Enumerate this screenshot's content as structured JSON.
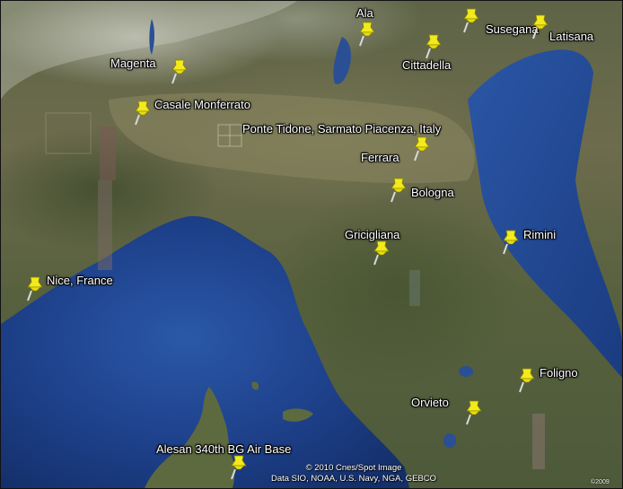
{
  "labels": {
    "ala": "Ala",
    "susegana": "Susegana",
    "latisana": "Latisana",
    "magenta": "Magenta",
    "cittadella": "Cittadella",
    "casale": "Casale Monferrato",
    "ponte": "Ponte Tidone, Sarmato Piacenza, Italy",
    "ferrara": "Ferrara",
    "bologna": "Bologna",
    "griciglia": "Griciglia­na",
    "rimini": "Rimini",
    "nice": "Nice, France",
    "foligno": "Foligno",
    "orvieto": "Orvieto",
    "alesan": "Alesan  340th BG Air Base"
  },
  "attribution": {
    "line1": "© 2010 Cnes/Spot Image",
    "line2": "Data SIO, NOAA, U.S. Navy, NGA, GEBCO",
    "year": "©2009"
  },
  "colors": {
    "sea": "#1c3f85",
    "pin": "#f2ea1c",
    "land": "#5e6446"
  },
  "icons": {
    "marker": "pushpin-icon"
  }
}
